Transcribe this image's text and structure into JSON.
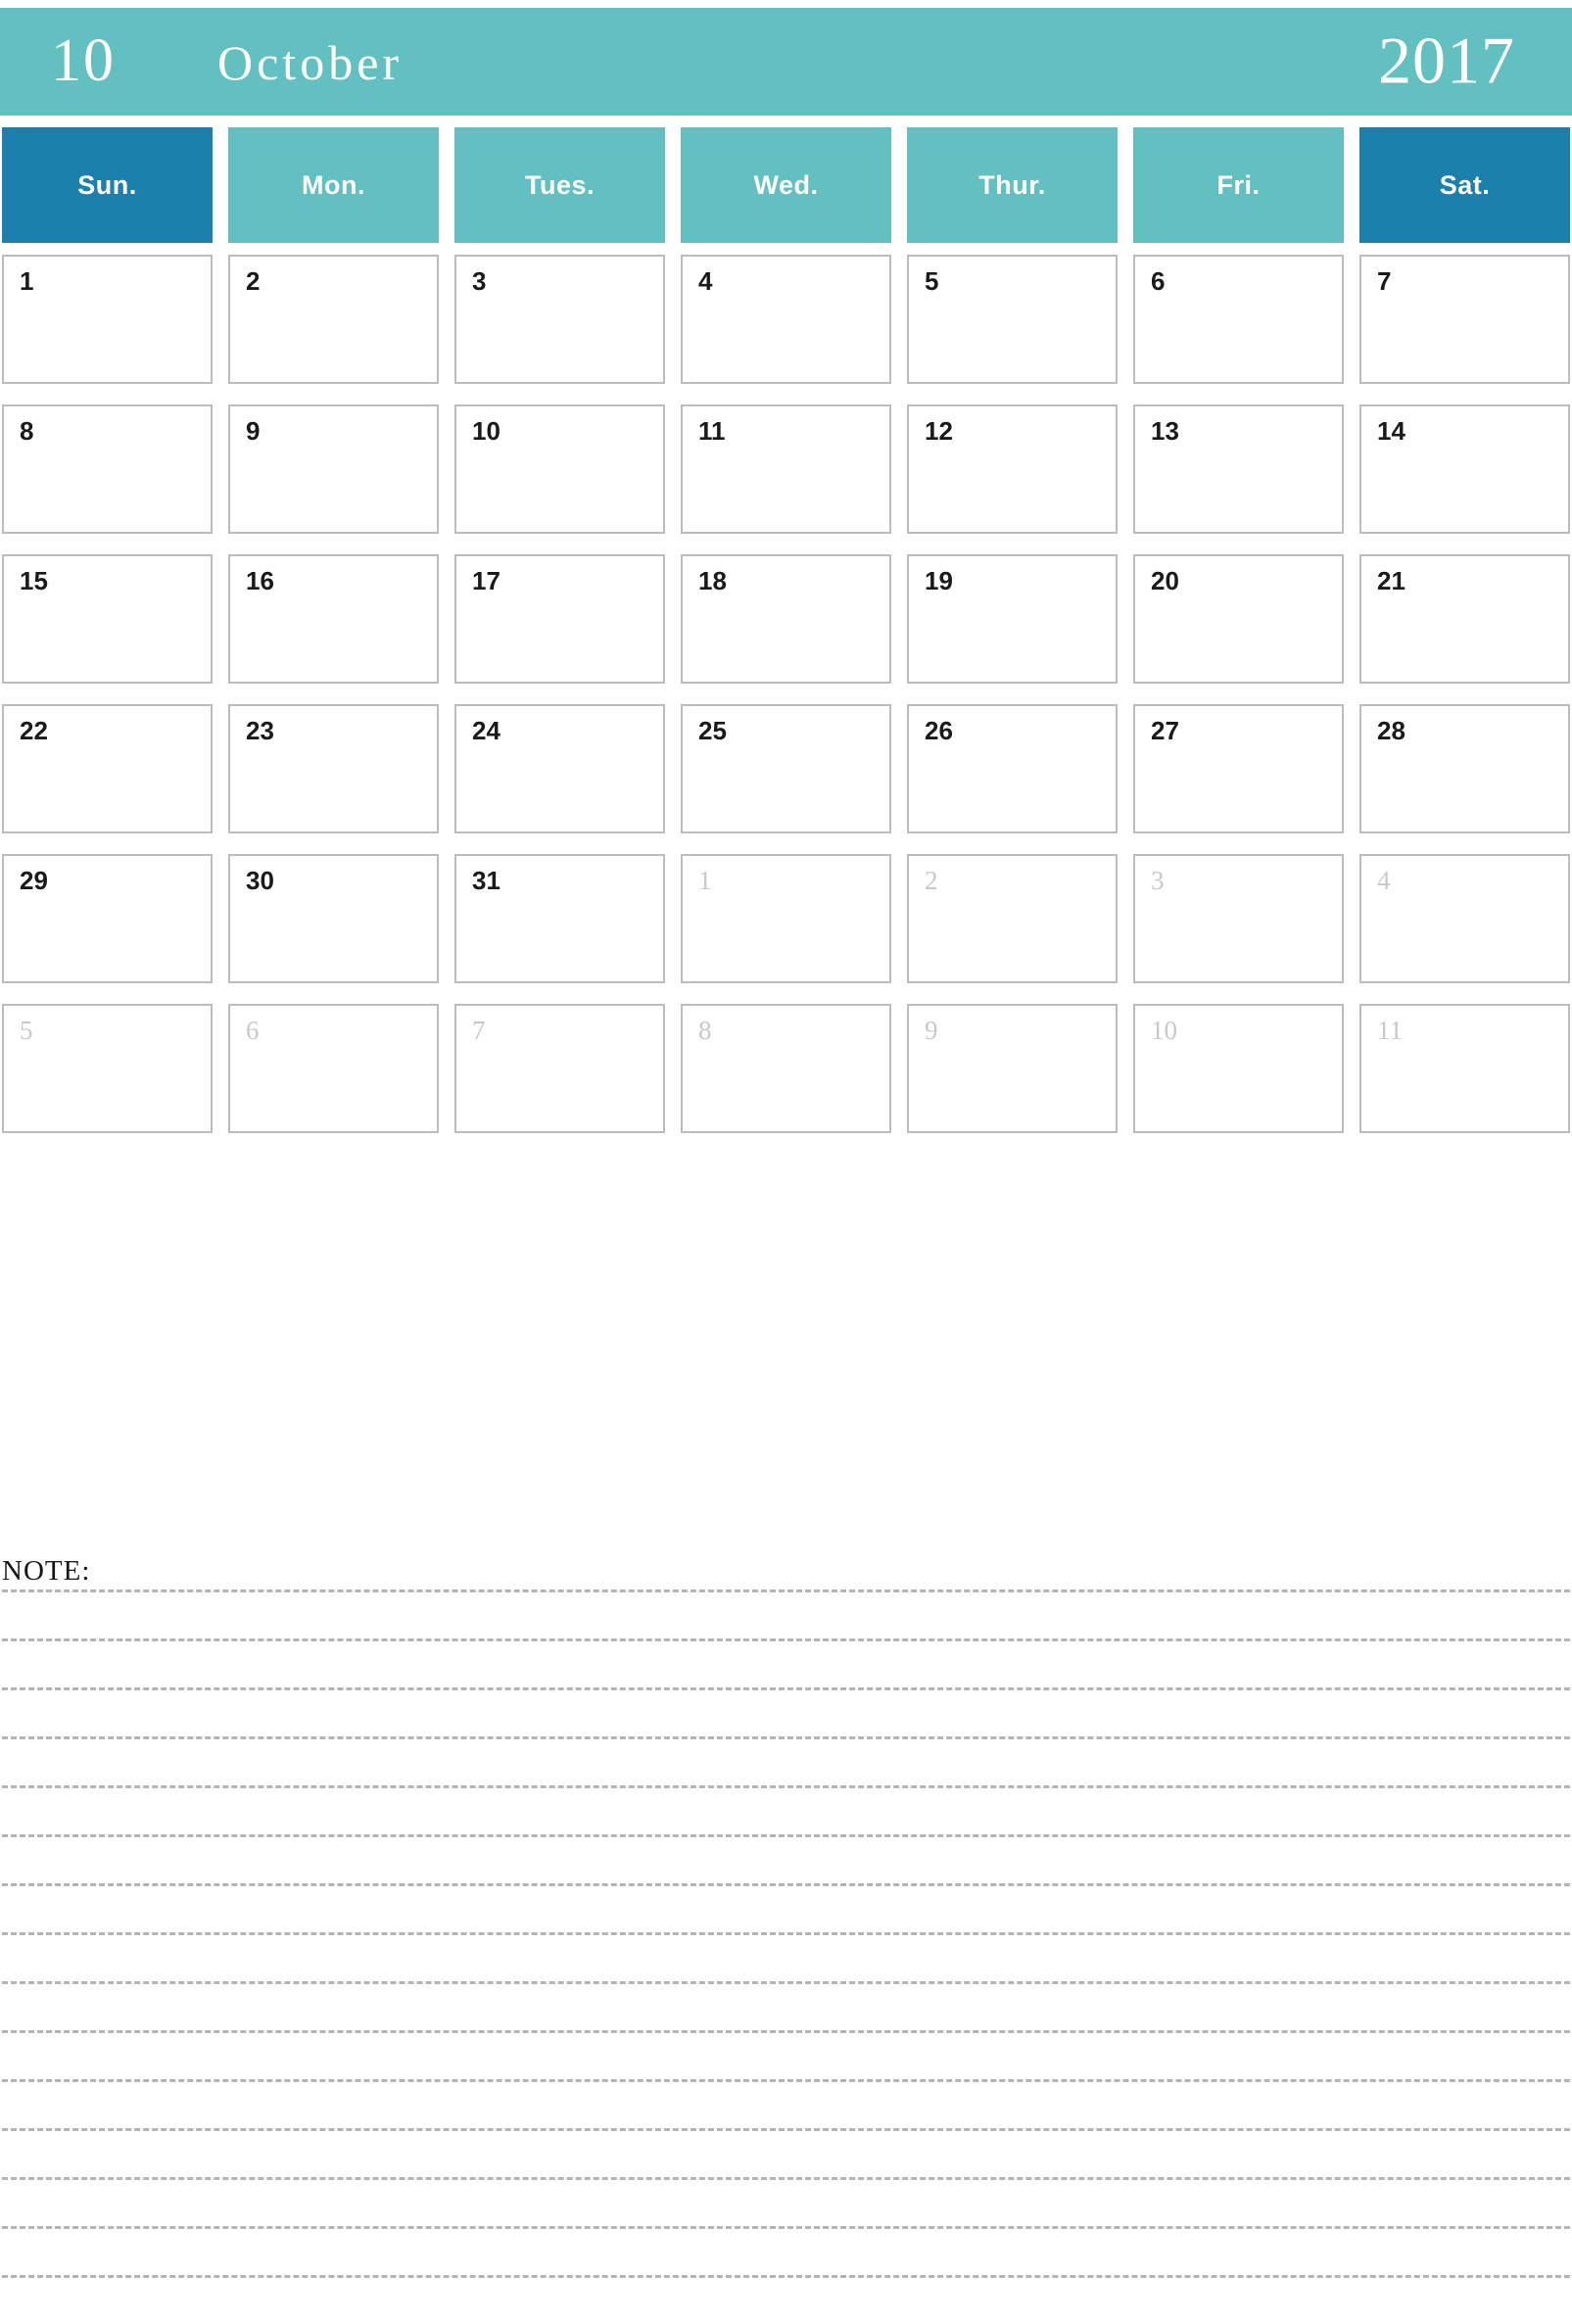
{
  "header": {
    "month_number": "10",
    "month_name": "October",
    "year": "2017",
    "banner_color": "#62c0c0"
  },
  "weekdays": [
    {
      "label": "Sun.",
      "weekend": true
    },
    {
      "label": "Mon.",
      "weekend": false
    },
    {
      "label": "Tues.",
      "weekend": false
    },
    {
      "label": "Wed.",
      "weekend": false
    },
    {
      "label": "Thur.",
      "weekend": false
    },
    {
      "label": "Fri.",
      "weekend": false
    },
    {
      "label": "Sat.",
      "weekend": true
    }
  ],
  "colors": {
    "teal": "#62c0c0",
    "weekend_blue": "#1b80ac",
    "cell_border": "#bcbcbc",
    "current_day_text": "#555555",
    "other_month_text": "#c9c9c9",
    "note_line": "#b4b4b4"
  },
  "weeks": [
    [
      {
        "day": "1",
        "current": true
      },
      {
        "day": "2",
        "current": true
      },
      {
        "day": "3",
        "current": true
      },
      {
        "day": "4",
        "current": true
      },
      {
        "day": "5",
        "current": true
      },
      {
        "day": "6",
        "current": true
      },
      {
        "day": "7",
        "current": true
      }
    ],
    [
      {
        "day": "8",
        "current": true
      },
      {
        "day": "9",
        "current": true
      },
      {
        "day": "10",
        "current": true
      },
      {
        "day": "11",
        "current": true
      },
      {
        "day": "12",
        "current": true
      },
      {
        "day": "13",
        "current": true
      },
      {
        "day": "14",
        "current": true
      }
    ],
    [
      {
        "day": "15",
        "current": true
      },
      {
        "day": "16",
        "current": true
      },
      {
        "day": "17",
        "current": true
      },
      {
        "day": "18",
        "current": true
      },
      {
        "day": "19",
        "current": true
      },
      {
        "day": "20",
        "current": true
      },
      {
        "day": "21",
        "current": true
      }
    ],
    [
      {
        "day": "22",
        "current": true
      },
      {
        "day": "23",
        "current": true
      },
      {
        "day": "24",
        "current": true
      },
      {
        "day": "25",
        "current": true
      },
      {
        "day": "26",
        "current": true
      },
      {
        "day": "27",
        "current": true
      },
      {
        "day": "28",
        "current": true
      }
    ],
    [
      {
        "day": "29",
        "current": true
      },
      {
        "day": "30",
        "current": true
      },
      {
        "day": "31",
        "current": true
      },
      {
        "day": "1",
        "current": false
      },
      {
        "day": "2",
        "current": false
      },
      {
        "day": "3",
        "current": false
      },
      {
        "day": "4",
        "current": false
      }
    ],
    [
      {
        "day": "5",
        "current": false
      },
      {
        "day": "6",
        "current": false
      },
      {
        "day": "7",
        "current": false
      },
      {
        "day": "8",
        "current": false
      },
      {
        "day": "9",
        "current": false
      },
      {
        "day": "10",
        "current": false
      },
      {
        "day": "11",
        "current": false
      }
    ]
  ],
  "note": {
    "label": "NOTE:",
    "line_count": 15
  }
}
